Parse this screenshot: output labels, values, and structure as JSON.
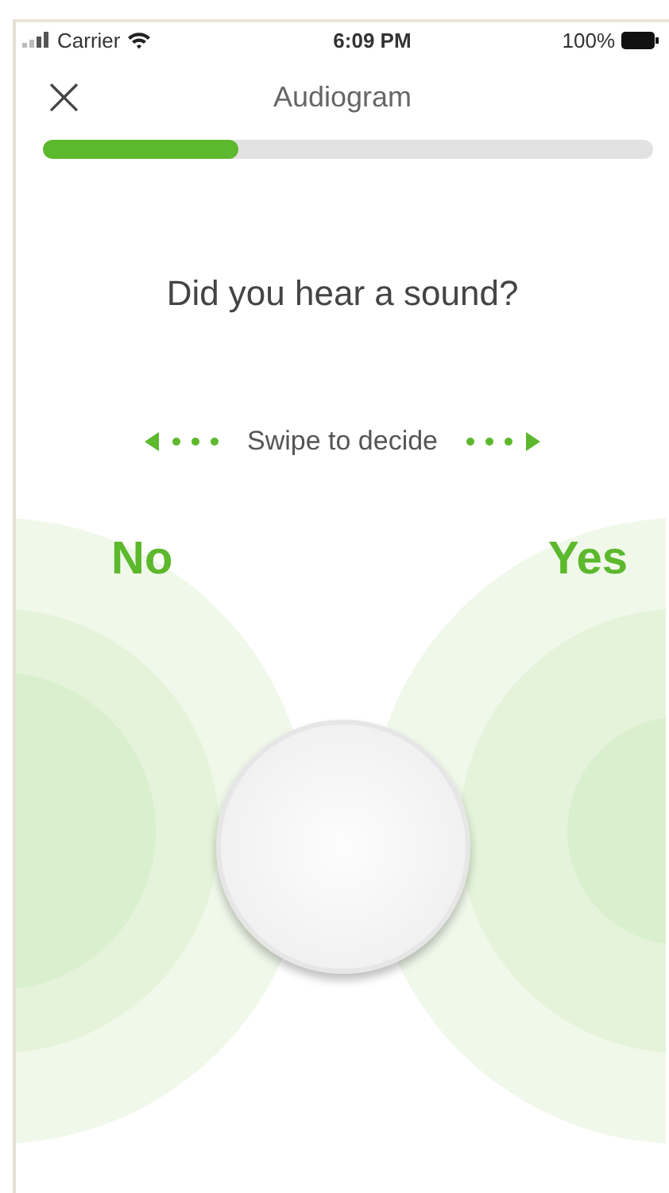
{
  "status_bar": {
    "carrier": "Carrier",
    "time": "6:09 PM",
    "battery": "100%"
  },
  "header": {
    "close": "×",
    "title": "Audiogram"
  },
  "progress": {
    "level": 0.32
  },
  "question": "Did you hear a sound?",
  "hint": "Swipe to decide",
  "choices": [
    {
      "label": "No"
    },
    {
      "label": "Yes"
    }
  ]
}
